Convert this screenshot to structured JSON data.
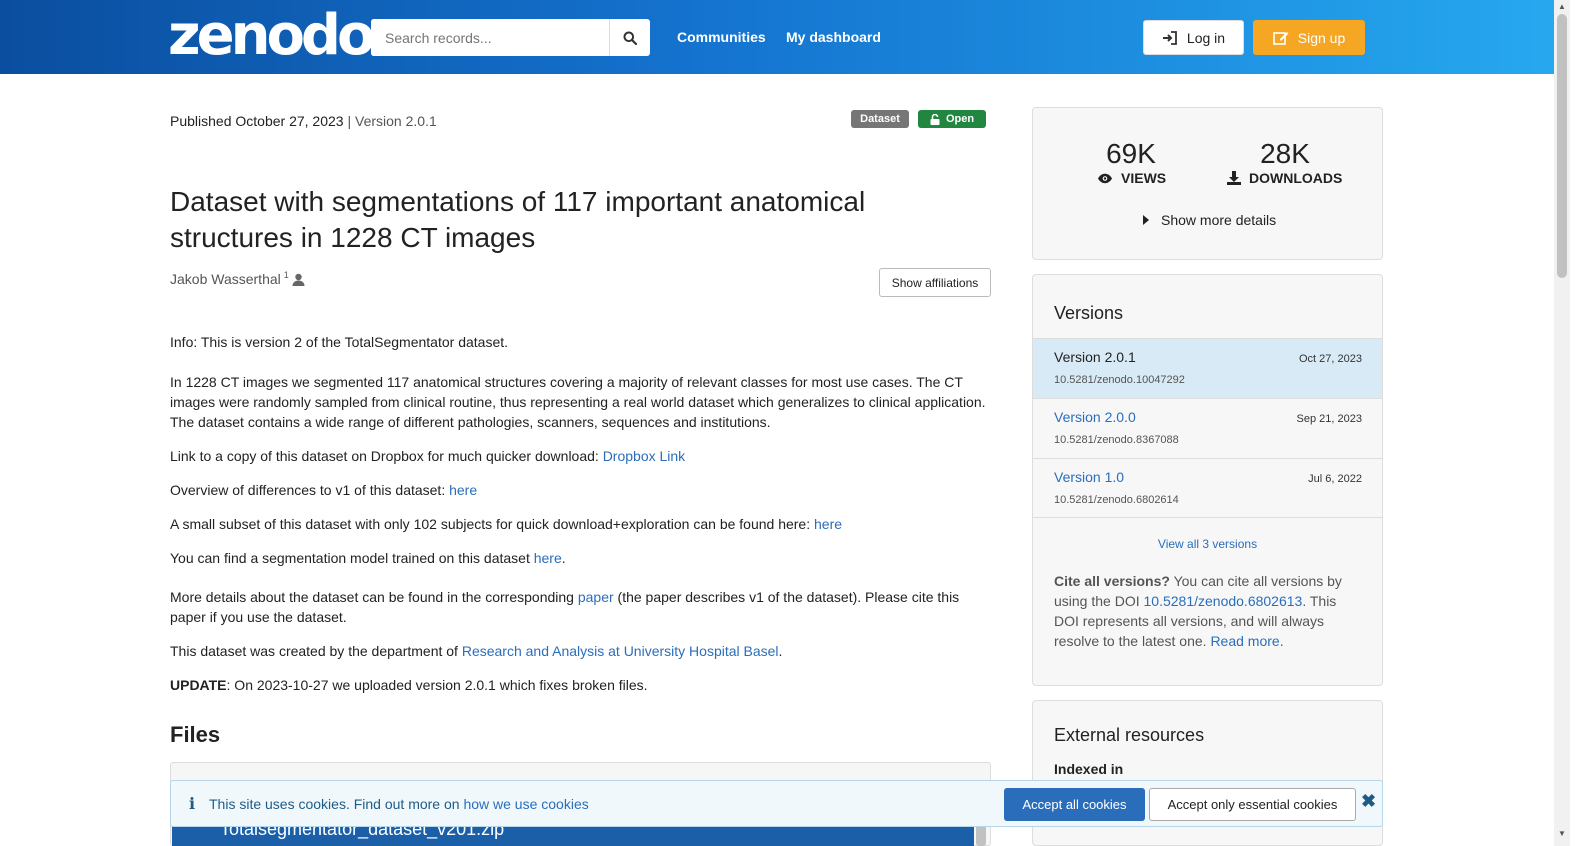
{
  "header": {
    "logo": "zenodo",
    "search_placeholder": "Search records...",
    "nav": [
      "Communities",
      "My dashboard"
    ],
    "login": "Log in",
    "signup": "Sign up"
  },
  "record": {
    "published": "Published October 27, 2023",
    "separator": "|",
    "version": "Version 2.0.1",
    "badge_type": "Dataset",
    "badge_access": "Open",
    "title": "Dataset with segmentations of 117 important anatomical structures in 1228 CT images",
    "creator": "Jakob Wasserthal",
    "creator_sup": "1",
    "show_affiliations": "Show affiliations"
  },
  "description": {
    "p1": "Info: This is version 2 of the TotalSegmentator dataset.",
    "p2": "In 1228 CT images we segmented 117 anatomical structures covering a majority of relevant classes for most use cases. The CT images were randomly sampled from clinical routine, thus representing a real world dataset which generalizes to clinical application. The dataset contains a wide range of different pathologies, scanners, sequences and institutions.",
    "p3_text": "Link to a copy of this dataset on Dropbox for much quicker download: ",
    "p3_link": "Dropbox Link",
    "p4_text": "Overview of differences to v1 of this dataset: ",
    "p4_link": "here",
    "p5_text": "A small subset of this dataset with only 102 subjects for quick download+exploration can be found here: ",
    "p5_link": "here",
    "p6_text": "You can find a segmentation model trained on this dataset ",
    "p6_link": "here",
    "p6_end": ".",
    "p7_text": "More details about the dataset can be found in the corresponding ",
    "p7_link": "paper",
    "p7_end": " (the paper describes v1 of the dataset). Please cite this paper if you use the dataset.",
    "p8_text": "This dataset was created by the department of ",
    "p8_link": "Research and Analysis at University Hospital Basel",
    "p8_end": ".",
    "p9_bold": "UPDATE",
    "p9_text": ": On 2023-10-27 we uploaded version 2.0.1 which fixes broken files."
  },
  "files": {
    "heading": "Files",
    "file_name": "Totalsegmentator_dataset_v201.zip"
  },
  "stats": {
    "views": "69K",
    "views_label": "VIEWS",
    "downloads": "28K",
    "downloads_label": "DOWNLOADS",
    "more": "Show more details"
  },
  "versions": {
    "title": "Versions",
    "items": [
      {
        "name": "Version 2.0.1",
        "doi": "10.5281/zenodo.10047292",
        "date": "Oct 27, 2023"
      },
      {
        "name": "Version 2.0.0",
        "doi": "10.5281/zenodo.8367088",
        "date": "Sep 21, 2023"
      },
      {
        "name": "Version 1.0",
        "doi": "10.5281/zenodo.6802614",
        "date": "Jul 6, 2022"
      }
    ],
    "view_all": "View all 3 versions",
    "cite_bold": "Cite all versions?",
    "cite_text1": " You can cite all versions by using the DOI ",
    "cite_doi": "10.5281/zenodo.6802613",
    "cite_text2": ". This DOI represents all versions, and will always resolve to the latest one. ",
    "read_more": "Read more",
    "cite_end": "."
  },
  "external": {
    "title": "External resources",
    "indexed": "Indexed in"
  },
  "cookie": {
    "info_icon": "i",
    "text": "This site uses cookies. Find out more on ",
    "link": "how we use cookies",
    "accept_all": "Accept all cookies",
    "accept_essential": "Accept only essential cookies",
    "close": "✖"
  },
  "colors": {
    "brand_blue": "#0b4e9f",
    "signup_orange": "#f5a623",
    "open_green": "#21863f",
    "link_blue": "#2a6ebb"
  }
}
